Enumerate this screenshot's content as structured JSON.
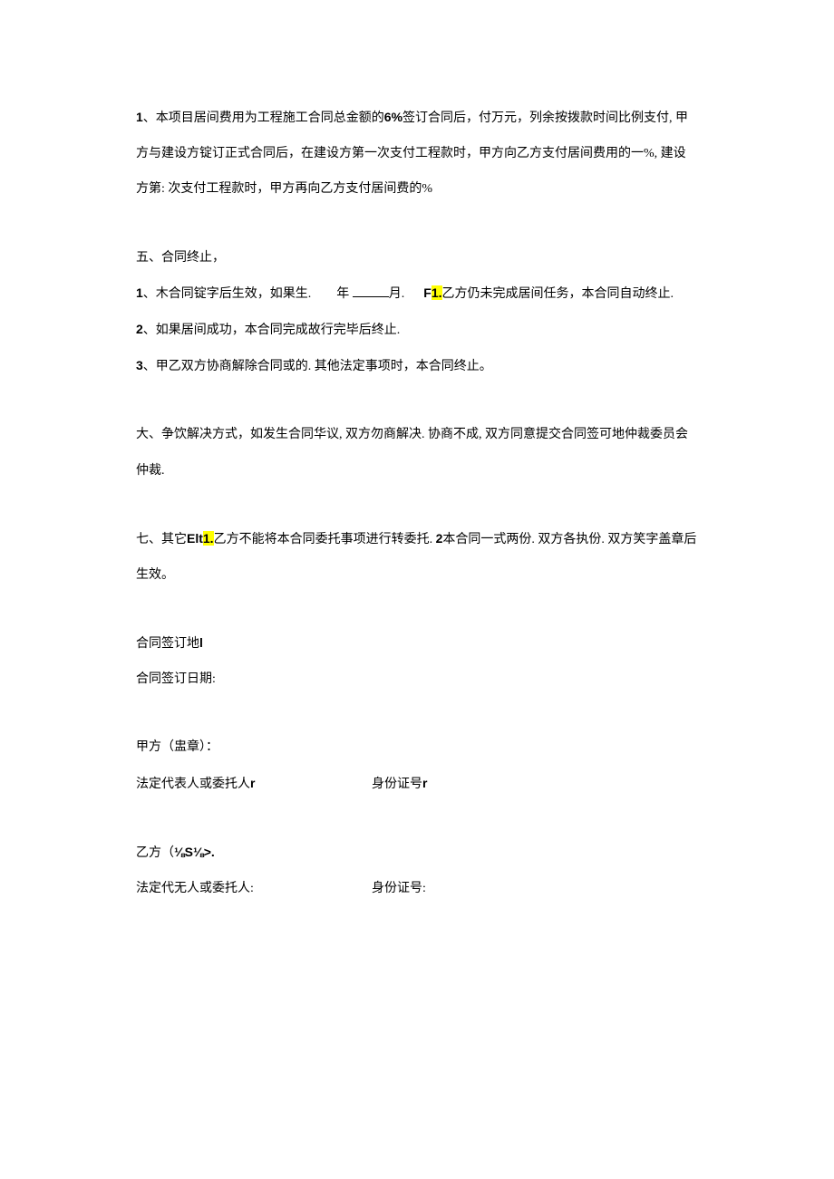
{
  "p1": {
    "num": "1",
    "sep": "、",
    "t1": "本项目居间费用为工程施工合同总金额的",
    "pct": "6%",
    "t2": "签订合同后，付万元，列余按拨款时间比例支付, 甲方与建设方锭订正式合同后，在建设方第一次支付工程款时，甲方向乙方支付居间费用的一%, 建设方第: 次支付工程款时，甲方再向乙方支付居间费的%"
  },
  "s5": {
    "heading": "五、合同终止，",
    "l1": {
      "num": "1",
      "sep": "、",
      "t1": "木合同锭字后生效，如果生.",
      "t2": "年",
      "t3": "月.",
      "f1": "F",
      "f1hl": "1.",
      "t4": "乙方仍未完成居间任务，本合同自动终止."
    },
    "l2": {
      "num": "2",
      "sep": "、",
      "t": "如果居间成功，本合同完成故行完毕后终止."
    },
    "l3": {
      "num": "3",
      "sep": "、",
      "t": "甲乙双方协商解除合同或的. 其他法定事项时，本合同终止。"
    }
  },
  "s6": {
    "t": "大、争饮解决方式，如发生合同华议, 双方勿商解决. 协商不成, 双方同意提交合同签可地仲裁委员会仲裁."
  },
  "s7": {
    "t1": "七、其它",
    "elt": "Elt",
    "hl": "1.",
    "t2": "乙方不能将本合同委托事项进行转委托. ",
    "two": "2",
    "t3": "本合同一式两份. 双方各执份. 双方笑字盖章后生效。"
  },
  "sign": {
    "place": "合同签订地",
    "place_suffix": "l",
    "date": "合同签订日期:",
    "a_title": "甲方（盅章）：",
    "a_rep": "法定代表人或委托人",
    "a_r": "r",
    "a_id": "身份证号",
    "a_id_r": "r",
    "b_title": "乙方（",
    "b_garble": "⅛S⅛>",
    "b_dot": ".",
    "b_rep": "法定代无人或委托人:",
    "b_id": "身份证号:"
  }
}
